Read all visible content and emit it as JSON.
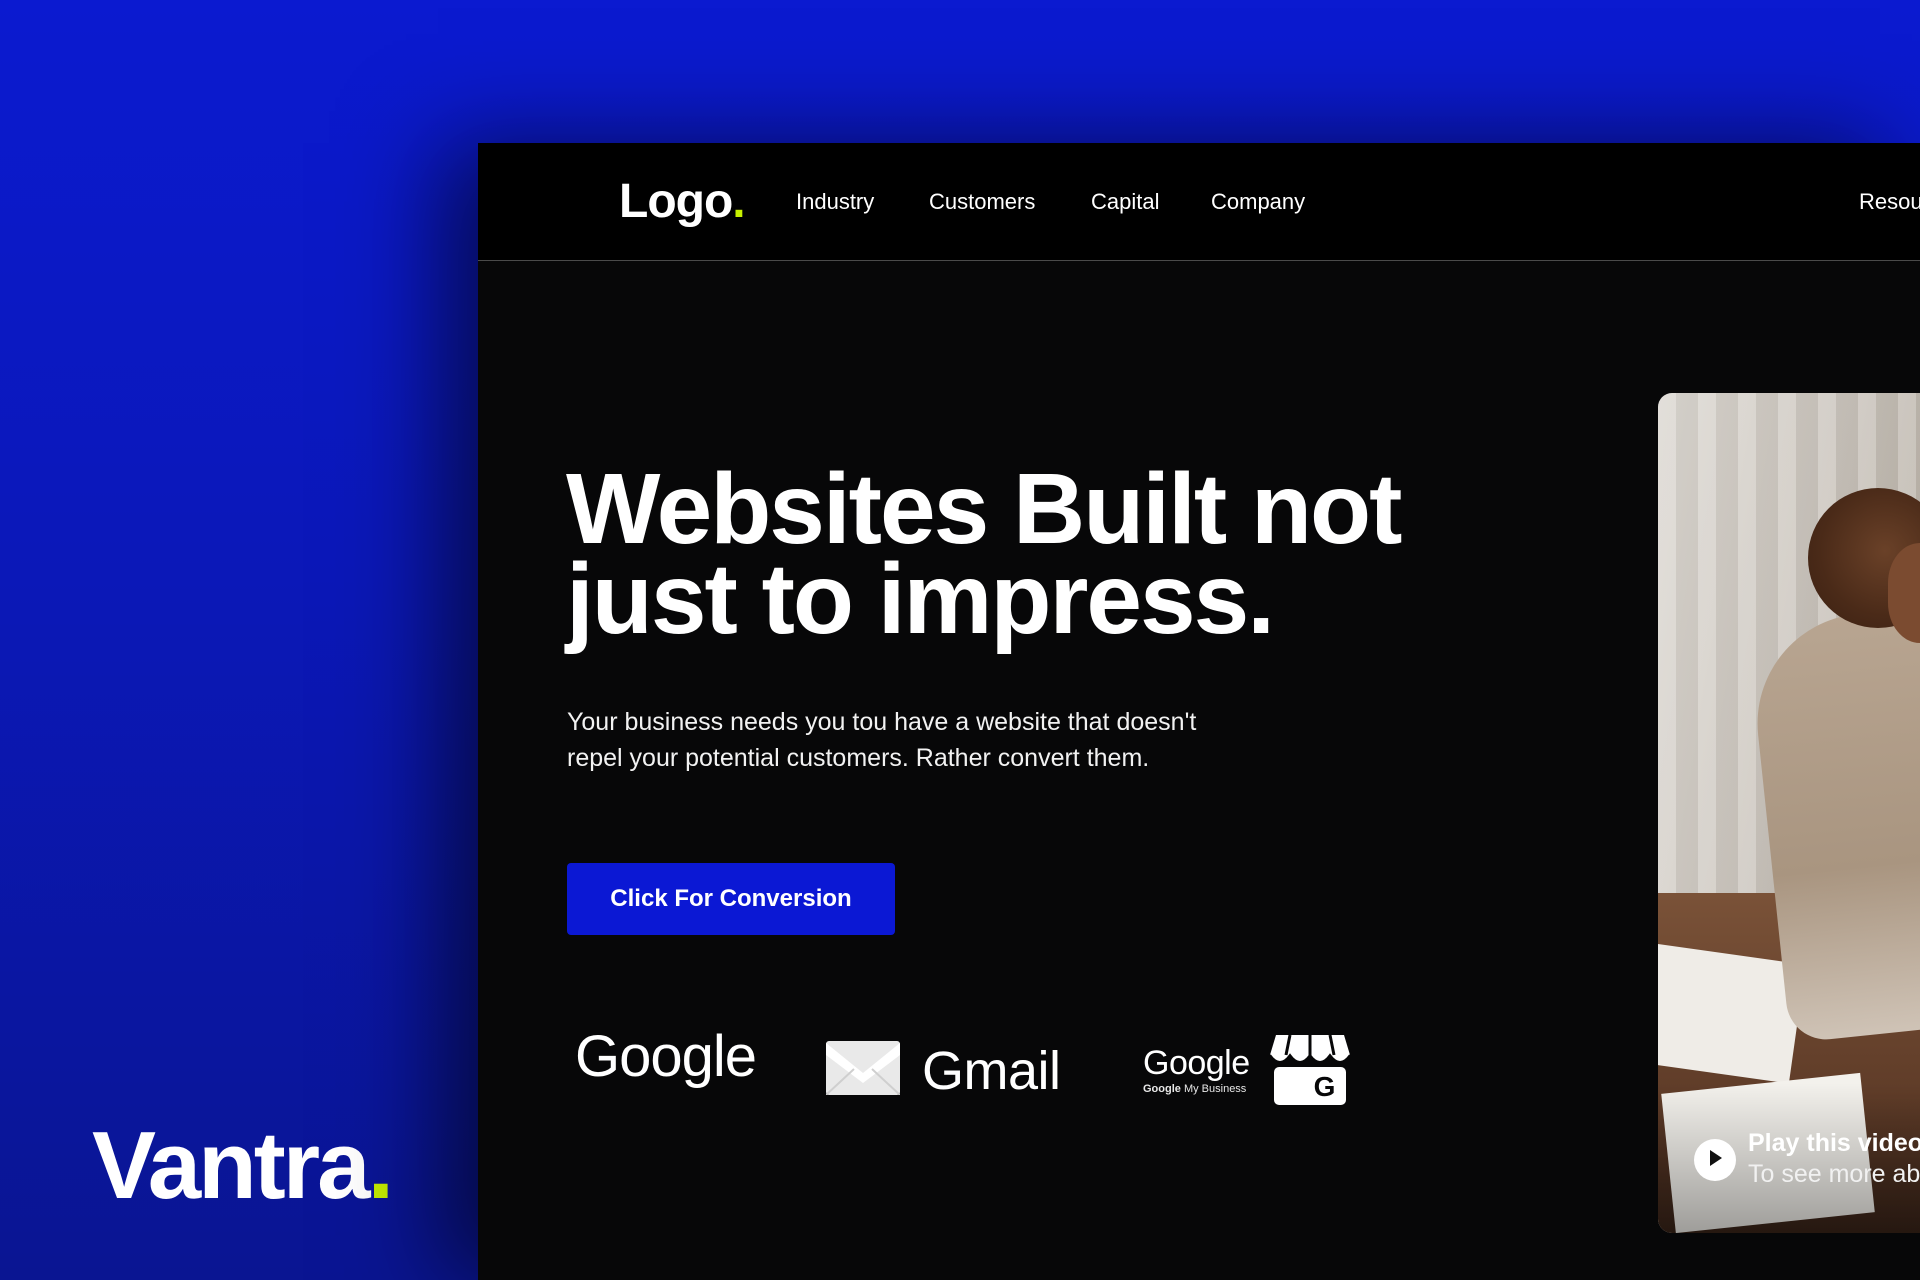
{
  "brand": {
    "name": "Vantra",
    "dot": ".",
    "dot_color": "#c7f000",
    "background": "#0b1ad0"
  },
  "site": {
    "nav": {
      "logo": "Logo",
      "logo_dot": ".",
      "items": [
        "Industry",
        "Customers",
        "Capital",
        "Company"
      ],
      "right_item": "Resou"
    },
    "hero": {
      "title_line1": "Websites Built not",
      "title_line2": "just to impress.",
      "subtitle_line1": "Your business needs you tou have a website that doesn't",
      "subtitle_line2": "repel your potential customers. Rather convert them.",
      "cta_label": "Click For Conversion",
      "cta_color": "#0b18d4"
    },
    "partners": {
      "google": "Google",
      "gmail": "Gmail",
      "gmb_main": "Google",
      "gmb_sub_bold": "Google",
      "gmb_sub_rest": "My Business",
      "gmb_badge": "G"
    },
    "video": {
      "title": "Play this video",
      "subtitle": "To see more ab",
      "play_icon": "play-icon"
    }
  }
}
